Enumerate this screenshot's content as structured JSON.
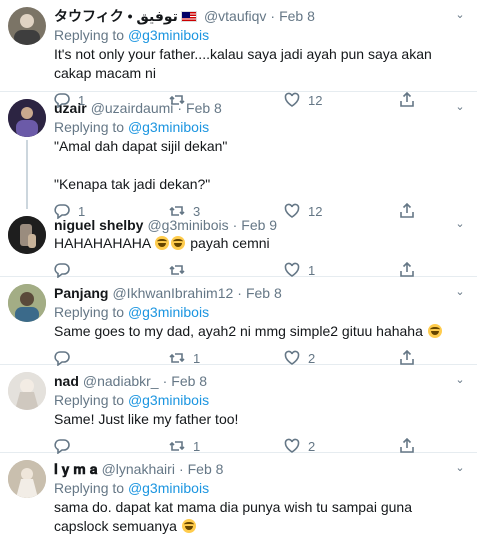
{
  "reply_prefix": "Replying to",
  "tweets": [
    {
      "name": "タウフィク • توفيق",
      "flag": "malaysia-flag",
      "handle": "@vtaufiqv",
      "date": "Feb 8",
      "reply_to": "@g3minibois",
      "text": "It's not only your father....kalau saya jadi ayah pun saya akan cakap macam ni",
      "replies": "1",
      "retweets": "",
      "likes": "12",
      "avatar_color": "#7b7466"
    },
    {
      "name": "uzair",
      "handle": "@uzairdaumi",
      "date": "Feb 8",
      "reply_to": "@g3minibois",
      "text": "\"Amal dah dapat sijil dekan\"\n\n\"Kenapa tak jadi dekan?\"",
      "replies": "1",
      "retweets": "3",
      "likes": "12",
      "avatar_color": "#3a2f55"
    },
    {
      "name": "niguel shelby",
      "handle": "@g3minibois",
      "date": "Feb 9",
      "reply_to": "",
      "text_before": "HAHAHAHAHA ",
      "text_after": " payah cemni",
      "replies": "",
      "retweets": "",
      "likes": "1",
      "avatar_color": "#2b2b2b"
    },
    {
      "name": "Panjang",
      "handle": "@IkhwanIbrahim12",
      "date": "Feb 8",
      "reply_to": "@g3minibois",
      "text": "Same goes to my dad, ayah2 ni mmg simple2 gituu hahaha",
      "replies": "",
      "retweets": "1",
      "likes": "2",
      "avatar_color": "#8e9a6e"
    },
    {
      "name": "nad",
      "handle": "@nadiabkr_",
      "date": "Feb 8",
      "reply_to": "@g3minibois",
      "text": "Same! Just like my father too!",
      "replies": "",
      "retweets": "1",
      "likes": "2",
      "avatar_color": "#d6d3cf"
    },
    {
      "name": "𝐥 𝐲 𝐦 𝐚",
      "handle": "@lynakhairi",
      "date": "Feb 8",
      "reply_to": "@g3minibois",
      "text": "sama do. dapat kat mama dia punya wish tu sampai guna capslock semuanya",
      "replies": "",
      "retweets": "",
      "likes": "",
      "avatar_color": "#b9ad9c"
    }
  ],
  "icons": {
    "reply": "reply-icon",
    "retweet": "retweet-icon",
    "like": "heart-icon",
    "share": "share-icon",
    "caret": "chevron-down-icon"
  },
  "colors": {
    "link": "#1b95e0",
    "muted": "#657786",
    "divider": "#e6ecf0"
  }
}
